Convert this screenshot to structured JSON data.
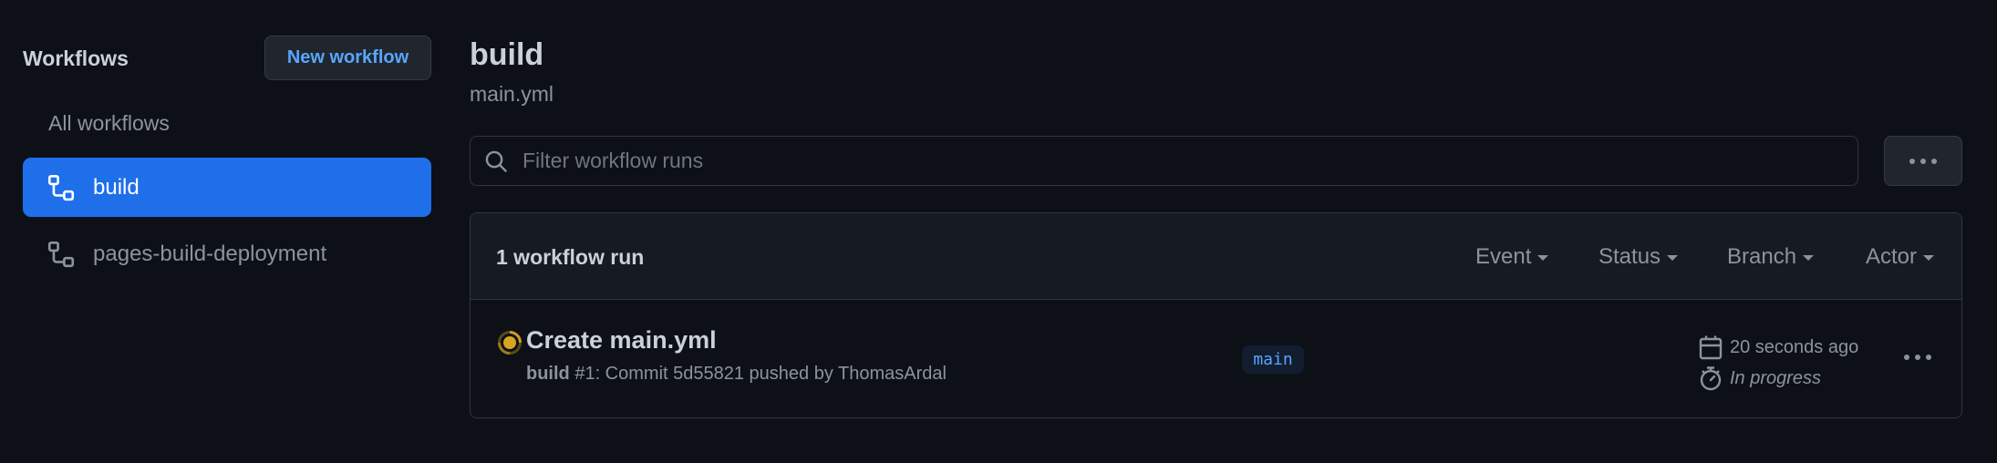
{
  "sidebar": {
    "title": "Workflows",
    "new_workflow_label": "New workflow",
    "all_workflows_label": "All workflows",
    "items": [
      {
        "label": "build",
        "icon": "workflow-icon",
        "active": true
      },
      {
        "label": "pages-build-deployment",
        "icon": "workflow-icon",
        "active": false
      }
    ]
  },
  "main": {
    "title": "build",
    "subtitle": "main.yml",
    "search": {
      "placeholder": "Filter workflow runs",
      "value": ""
    },
    "more_button_icon": "kebab-horizontal-icon",
    "runs_box": {
      "count_label": "1 workflow run",
      "filters": [
        "Event",
        "Status",
        "Branch",
        "Actor"
      ],
      "runs": [
        {
          "status": "in_progress",
          "status_color": "#d29922",
          "title": "Create main.yml",
          "workflow": "build",
          "detail": " #1: Commit 5d55821 pushed by ThomasArdal",
          "branch": "main",
          "time": "20 seconds ago",
          "duration": "In progress"
        }
      ]
    }
  },
  "colors": {
    "background": "#0d1117",
    "accent": "#1f6feb",
    "link": "#58a6ff",
    "muted": "#8b949e",
    "border": "#30363d"
  }
}
